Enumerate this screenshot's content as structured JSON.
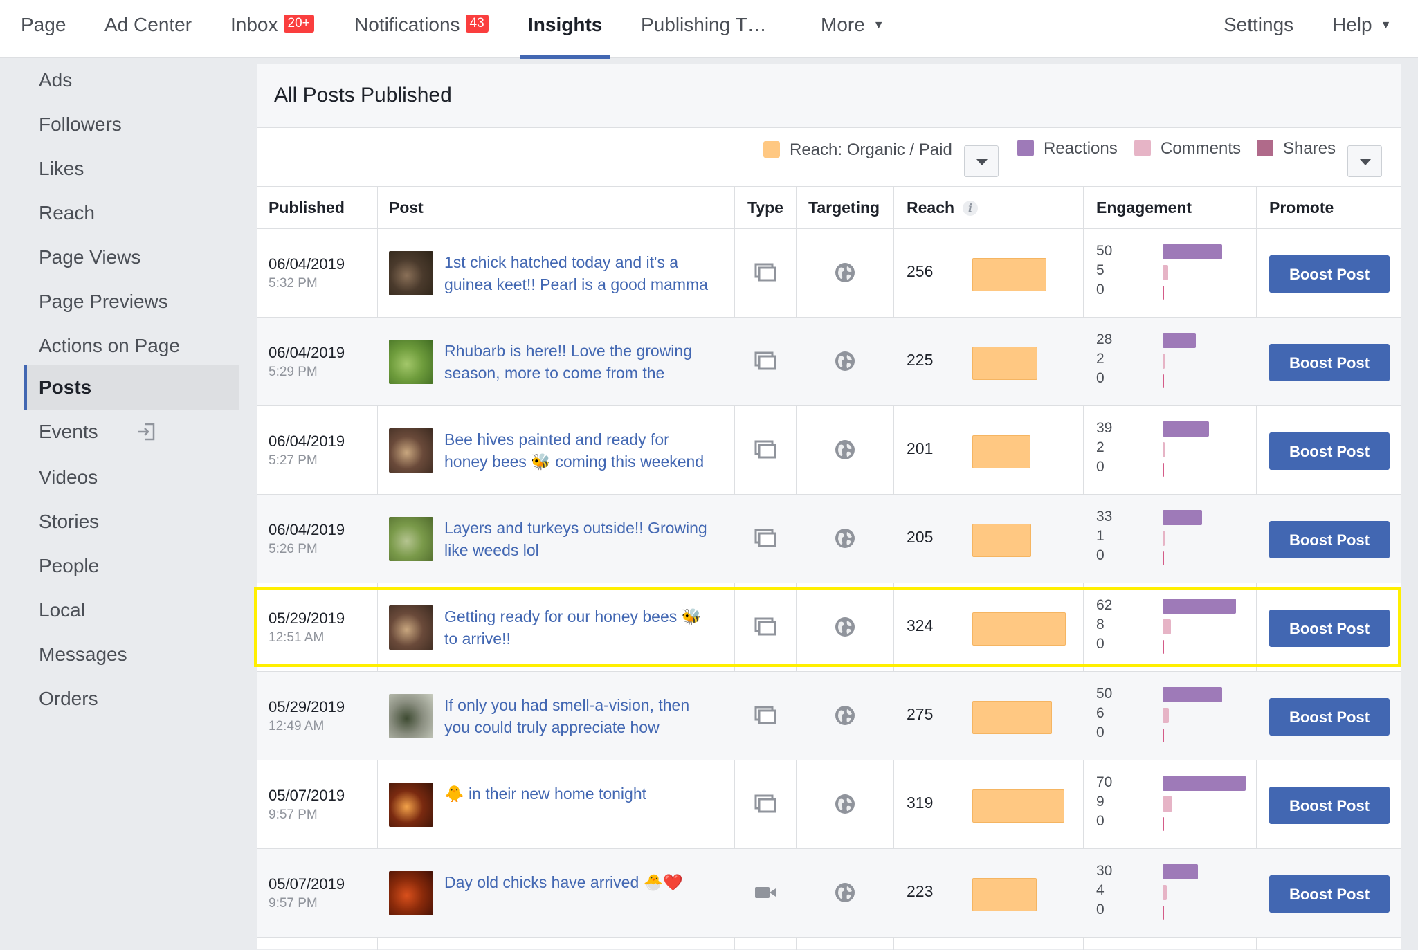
{
  "topnav": {
    "items": [
      {
        "label": "Page"
      },
      {
        "label": "Ad Center"
      },
      {
        "label": "Inbox",
        "badge": "20+"
      },
      {
        "label": "Notifications",
        "badge": "43"
      },
      {
        "label": "Insights",
        "active": true
      },
      {
        "label": "Publishing T…"
      },
      {
        "label": "More"
      }
    ],
    "settings_label": "Settings",
    "help_label": "Help"
  },
  "sidebar": {
    "items": [
      {
        "label": "Ads"
      },
      {
        "label": "Followers"
      },
      {
        "label": "Likes"
      },
      {
        "label": "Reach"
      },
      {
        "label": "Page Views"
      },
      {
        "label": "Page Previews"
      },
      {
        "label": "Actions on Page"
      },
      {
        "label": "Posts",
        "active": true
      },
      {
        "label": "Events"
      },
      {
        "label": "Videos"
      },
      {
        "label": "Stories"
      },
      {
        "label": "People"
      },
      {
        "label": "Local"
      },
      {
        "label": "Messages"
      },
      {
        "label": "Orders"
      }
    ]
  },
  "panel": {
    "title": "All Posts Published",
    "legend": {
      "reach": "Reach: Organic / Paid",
      "reactions": "Reactions",
      "comments": "Comments",
      "shares": "Shares"
    },
    "columns": {
      "published": "Published",
      "post": "Post",
      "type": "Type",
      "targeting": "Targeting",
      "reach": "Reach",
      "engagement": "Engagement",
      "promote": "Promote"
    },
    "boost_label": "Boost Post"
  },
  "colors": {
    "accent": "#4267b2",
    "reach": "#ffc882",
    "reactions": "#9e7ab8",
    "comments": "#e6b4c6",
    "shares": "#b06a8a",
    "highlight": "#ffef00"
  },
  "posts": [
    {
      "date": "06/04/2019",
      "time": "5:32 PM",
      "line1": "1st chick hatched today and it's a",
      "line2": "guinea keet!! Pearl is a good mamma",
      "type": "photo",
      "reach": 256,
      "reactions": 50,
      "comments": 5,
      "shares": 0
    },
    {
      "date": "06/04/2019",
      "time": "5:29 PM",
      "line1": "Rhubarb is here!! Love the growing",
      "line2": "season, more to come from the",
      "type": "photo",
      "reach": 225,
      "reactions": 28,
      "comments": 2,
      "shares": 0
    },
    {
      "date": "06/04/2019",
      "time": "5:27 PM",
      "line1": "Bee hives painted and ready for",
      "line2": "honey bees 🐝 coming this weekend",
      "type": "photo",
      "reach": 201,
      "reactions": 39,
      "comments": 2,
      "shares": 0
    },
    {
      "date": "06/04/2019",
      "time": "5:26 PM",
      "line1": "Layers and turkeys outside!! Growing",
      "line2": "like weeds lol",
      "type": "photo",
      "reach": 205,
      "reactions": 33,
      "comments": 1,
      "shares": 0
    },
    {
      "date": "05/29/2019",
      "time": "12:51 AM",
      "line1": "Getting ready for our honey bees 🐝",
      "line2": "to arrive!!",
      "type": "photo",
      "reach": 324,
      "reactions": 62,
      "comments": 8,
      "shares": 0,
      "highlighted": true
    },
    {
      "date": "05/29/2019",
      "time": "12:49 AM",
      "line1": "If only you had smell-a-vision, then",
      "line2": "you could truly appreciate how",
      "type": "photo",
      "reach": 275,
      "reactions": 50,
      "comments": 6,
      "shares": 0
    },
    {
      "date": "05/07/2019",
      "time": "9:57 PM",
      "line1": "🐥 in their new home tonight",
      "line2": "",
      "type": "photo",
      "reach": 319,
      "reactions": 70,
      "comments": 9,
      "shares": 0
    },
    {
      "date": "05/07/2019",
      "time": "9:57 PM",
      "line1": "Day old chicks have arrived 🐣❤️",
      "line2": "",
      "type": "video",
      "reach": 223,
      "reactions": 30,
      "comments": 4,
      "shares": 0
    }
  ]
}
